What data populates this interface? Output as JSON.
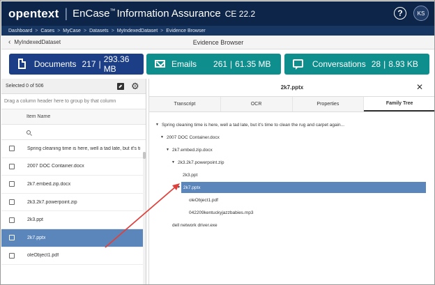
{
  "app": {
    "logo": "opentext",
    "separator": "|",
    "app_name": "EnCase",
    "app_name_mark": "™",
    "product": " Information Assurance",
    "version": "CE 22.2",
    "help_label": "?",
    "user_initials": "KS"
  },
  "breadcrumb": [
    "Dashboard",
    "Cases",
    "MyCase",
    "Datasets",
    "MyIndexedDataset",
    "Evidence Browser"
  ],
  "breadcrumb_sep": ">",
  "title_row": {
    "back_label": "MyIndexedDataset",
    "page_title": "Evidence Browser"
  },
  "cards": [
    {
      "label": "Documents",
      "count": "217",
      "size": "293.36 MB",
      "icon": "document-icon"
    },
    {
      "label": "Emails",
      "count": "261",
      "size": "61.35 MB",
      "icon": "mail-icon"
    },
    {
      "label": "Conversations",
      "count": "28",
      "size": "8.93 KB",
      "icon": "chat-icon"
    }
  ],
  "card_sep": "|",
  "left_panel": {
    "selection": "Selected 0 of 506",
    "group_hint": "Drag a column header here to group by that column",
    "column_header": "Item Name",
    "items": [
      {
        "name": "Spring cleaning time is here, well a tad late, but it's ti",
        "selected": false
      },
      {
        "name": "2007 DOC Container.docx",
        "selected": false
      },
      {
        "name": "2k7.embed.zip.docx",
        "selected": false
      },
      {
        "name": "2k3.2k7.powerpoint.zip",
        "selected": false
      },
      {
        "name": "2k3.ppt",
        "selected": false
      },
      {
        "name": "2k7.pptx",
        "selected": true
      },
      {
        "name": "oleObject1.pdf",
        "selected": false
      }
    ]
  },
  "right_panel": {
    "title": "2k7.pptx",
    "tabs": [
      {
        "label": "Transcript",
        "active": false
      },
      {
        "label": "OCR",
        "active": false
      },
      {
        "label": "Properties",
        "active": false
      },
      {
        "label": "Family Tree",
        "active": true
      }
    ],
    "tree": [
      {
        "label": "Spring cleaning time is here, well a tad late, but it's time to clean the rug and carpet again...",
        "expanded": true
      },
      {
        "label": "2007 DOC Container.docx",
        "expanded": true
      },
      {
        "label": "2k7.embed.zip.docx",
        "expanded": true
      },
      {
        "label": "2k3.2k7.powerpoint.zip",
        "expanded": true
      },
      {
        "label": "2k3.ppt",
        "expanded": false
      },
      {
        "label": "2k7.pptx",
        "expanded": true,
        "selected": true
      },
      {
        "label": "oleObject1.pdf",
        "expanded": false
      },
      {
        "label": "042209kentuckyjazzbabies.mp3",
        "expanded": false
      },
      {
        "label": "dell network driver.exe",
        "expanded": false
      }
    ]
  },
  "colors": {
    "header_bg": "#0d2548",
    "breadcrumb_bg": "#183662",
    "documents_card": "#1b3e87",
    "teal_card": "#0f8e8e",
    "selection": "#5b86bb",
    "annotation_arrow": "#e0403c"
  }
}
